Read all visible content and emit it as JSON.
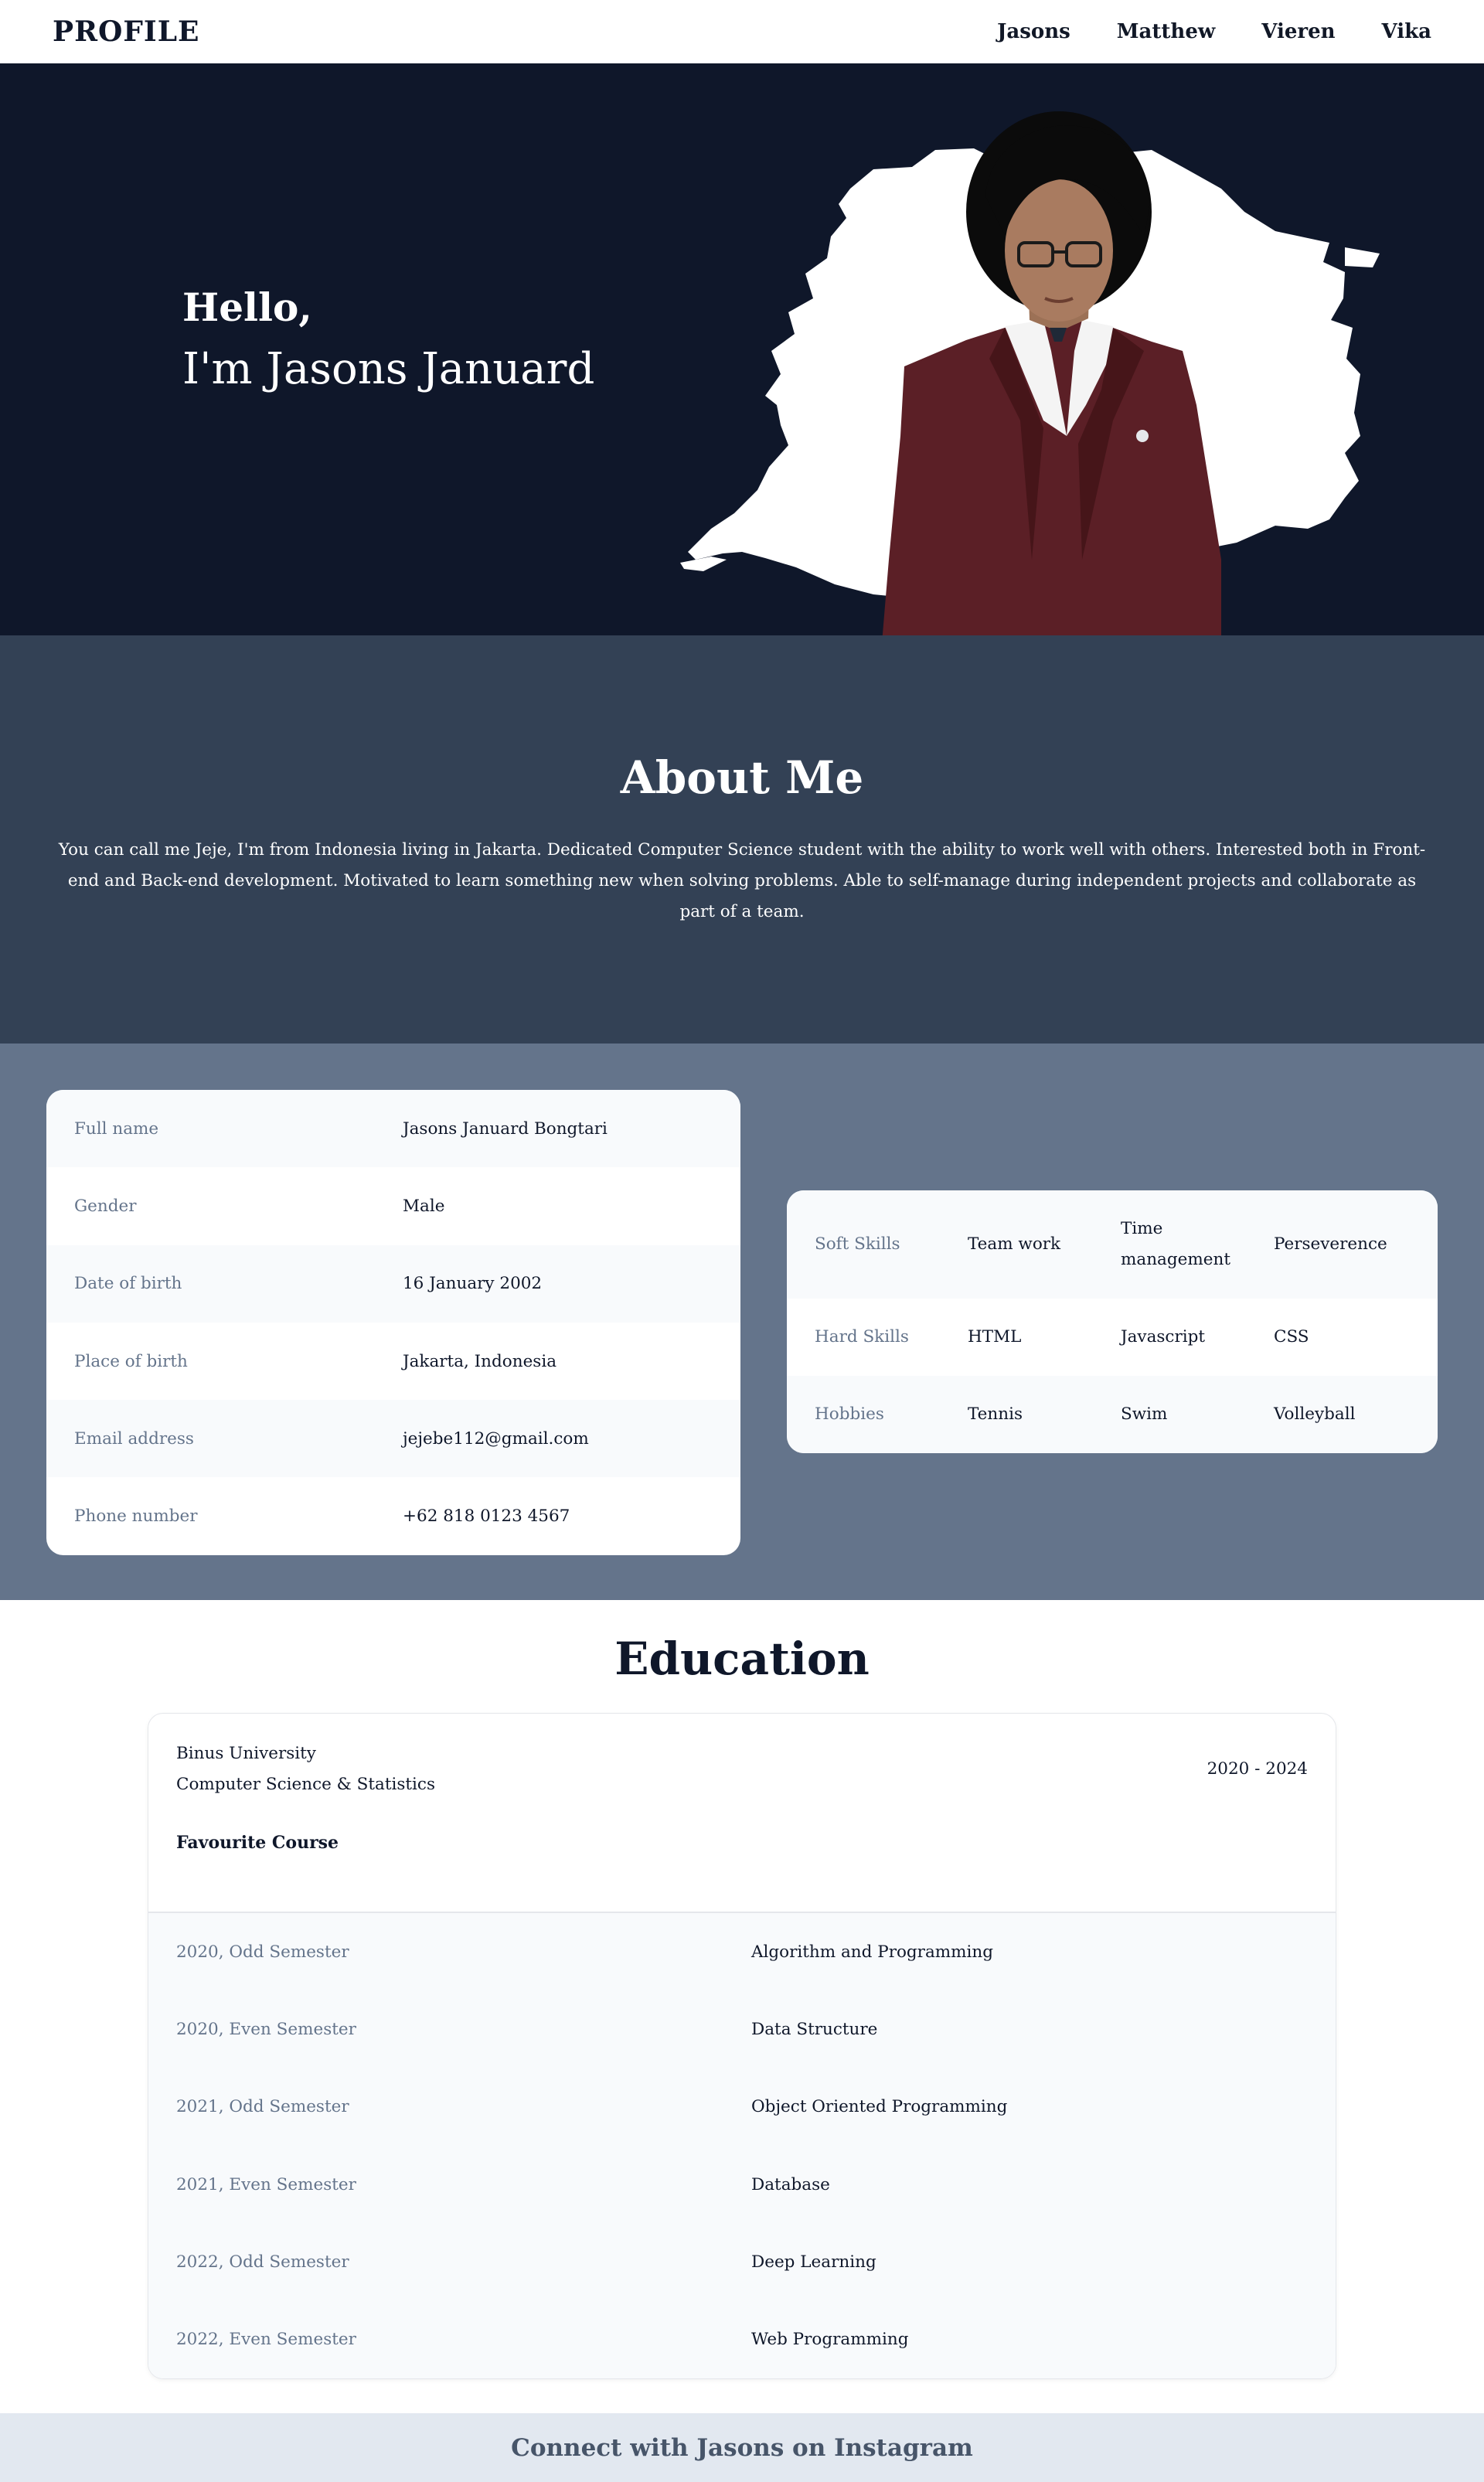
{
  "nav": {
    "brand": "PROFILE",
    "links": [
      "Jasons",
      "Matthew",
      "Vieren",
      "Vika"
    ]
  },
  "hero": {
    "greeting": "Hello,",
    "intro": "I'm Jasons Januard"
  },
  "about": {
    "title": "About Me",
    "text": "You can call me Jeje, I'm from Indonesia living in Jakarta. Dedicated Computer Science student with the ability to work well with others. Interested both in Front-end and Back-end development. Motivated to learn something new when solving problems. Able to self-manage during independent projects and collaborate as part of a team."
  },
  "personal": [
    {
      "label": "Full name",
      "value": "Jasons Januard Bongtari"
    },
    {
      "label": "Gender",
      "value": "Male"
    },
    {
      "label": "Date of birth",
      "value": "16 January 2002"
    },
    {
      "label": "Place of birth",
      "value": "Jakarta, Indonesia"
    },
    {
      "label": "Email address",
      "value": "jejebe112@gmail.com"
    },
    {
      "label": "Phone number",
      "value": "+62 818 0123 4567"
    }
  ],
  "skills": [
    {
      "label": "Soft Skills",
      "items": [
        "Team work",
        "Time management",
        "Perseverence"
      ]
    },
    {
      "label": "Hard Skills",
      "items": [
        "HTML",
        "Javascript",
        "CSS"
      ]
    },
    {
      "label": "Hobbies",
      "items": [
        "Tennis",
        "Swim",
        "Volleyball"
      ]
    }
  ],
  "education": {
    "title": "Education",
    "school": "Binus University",
    "major": "Computer Science & Statistics",
    "years": "2020 - 2024",
    "favourite_title": "Favourite Course",
    "courses": [
      {
        "semester": "2020, Odd Semester",
        "course": "Algorithm and Programming"
      },
      {
        "semester": "2020, Even Semester",
        "course": "Data Structure"
      },
      {
        "semester": "2021, Odd Semester",
        "course": "Object Oriented Programming"
      },
      {
        "semester": "2021, Even Semester",
        "course": "Database"
      },
      {
        "semester": "2022, Odd Semester",
        "course": "Deep Learning"
      },
      {
        "semester": "2022, Even Semester",
        "course": "Web Programming"
      }
    ]
  },
  "footer": {
    "text": "Connect with Jasons on Instagram"
  },
  "colors": {
    "hero_bg": "#0f172a",
    "about_bg": "#334155",
    "info_bg": "#64748b",
    "footer_bg": "#e2e8f0",
    "jacket": "#5b1f26"
  }
}
